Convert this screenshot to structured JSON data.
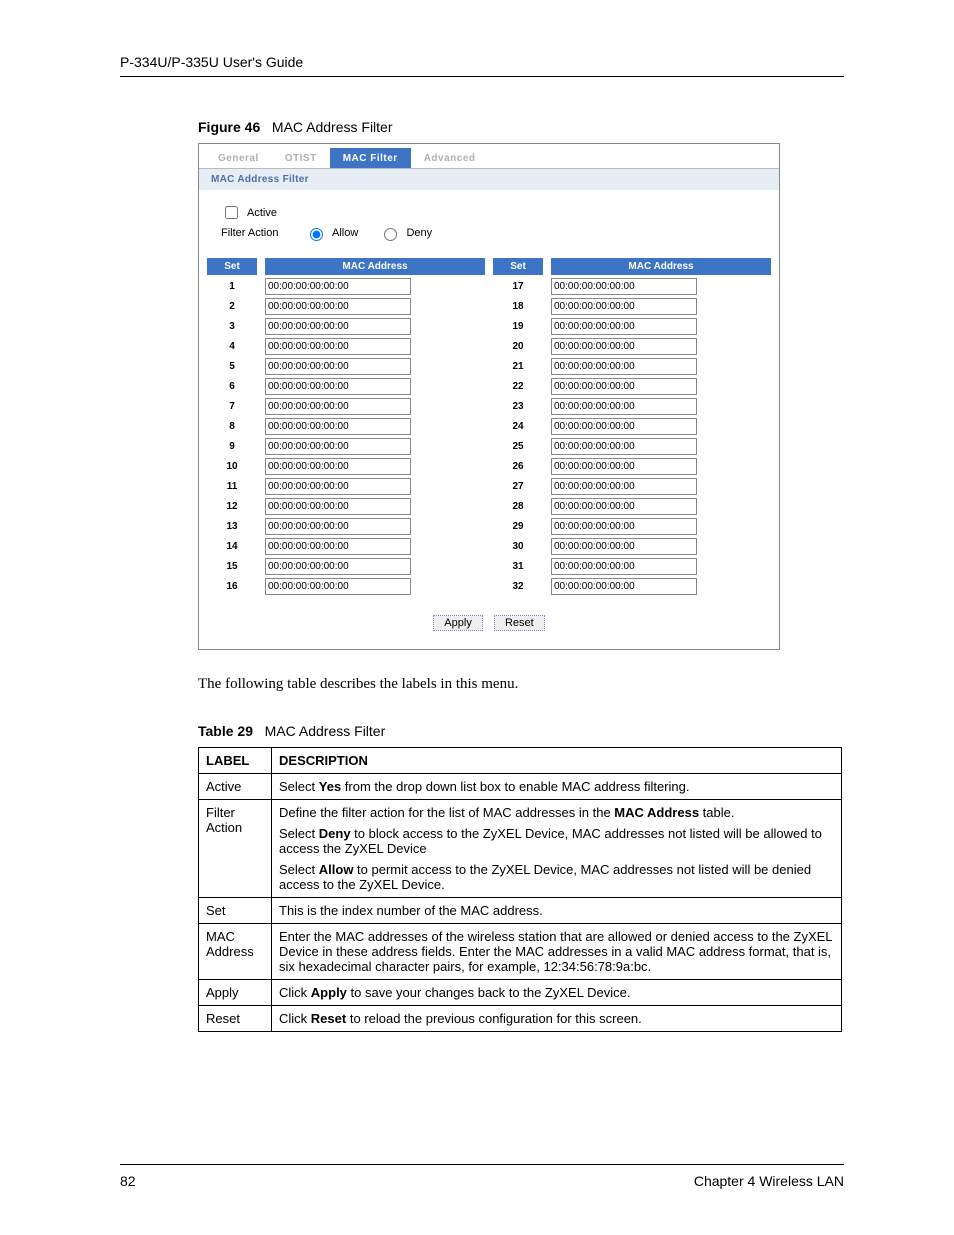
{
  "header": {
    "guide": "P-334U/P-335U User's Guide"
  },
  "figure": {
    "label": "Figure 46",
    "title": "MAC Address Filter"
  },
  "tabs": {
    "general": "General",
    "otist": "OTIST",
    "macfilter": "MAC Filter",
    "advanced": "Advanced"
  },
  "section": {
    "title": "MAC Address Filter"
  },
  "form": {
    "active_label": "Active",
    "filter_action_label": "Filter Action",
    "allow_label": "Allow",
    "deny_label": "Deny"
  },
  "grid_headers": {
    "set": "Set",
    "mac": "MAC Address"
  },
  "mac_rows": [
    {
      "n": "1",
      "v": "00:00:00:00:00:00"
    },
    {
      "n": "2",
      "v": "00:00:00:00:00:00"
    },
    {
      "n": "3",
      "v": "00:00:00:00:00:00"
    },
    {
      "n": "4",
      "v": "00:00:00:00:00:00"
    },
    {
      "n": "5",
      "v": "00:00:00:00:00:00"
    },
    {
      "n": "6",
      "v": "00:00:00:00:00:00"
    },
    {
      "n": "7",
      "v": "00:00:00:00:00:00"
    },
    {
      "n": "8",
      "v": "00:00:00:00:00:00"
    },
    {
      "n": "9",
      "v": "00:00:00:00:00:00"
    },
    {
      "n": "10",
      "v": "00:00:00:00:00:00"
    },
    {
      "n": "11",
      "v": "00:00:00:00:00:00"
    },
    {
      "n": "12",
      "v": "00:00:00:00:00:00"
    },
    {
      "n": "13",
      "v": "00:00:00:00:00:00"
    },
    {
      "n": "14",
      "v": "00:00:00:00:00:00"
    },
    {
      "n": "15",
      "v": "00:00:00:00:00:00"
    },
    {
      "n": "16",
      "v": "00:00:00:00:00:00"
    },
    {
      "n": "17",
      "v": "00:00:00:00:00:00"
    },
    {
      "n": "18",
      "v": "00:00:00:00:00:00"
    },
    {
      "n": "19",
      "v": "00:00:00:00:00:00"
    },
    {
      "n": "20",
      "v": "00:00:00:00:00:00"
    },
    {
      "n": "21",
      "v": "00:00:00:00:00:00"
    },
    {
      "n": "22",
      "v": "00:00:00:00:00:00"
    },
    {
      "n": "23",
      "v": "00:00:00:00:00:00"
    },
    {
      "n": "24",
      "v": "00:00:00:00:00:00"
    },
    {
      "n": "25",
      "v": "00:00:00:00:00:00"
    },
    {
      "n": "26",
      "v": "00:00:00:00:00:00"
    },
    {
      "n": "27",
      "v": "00:00:00:00:00:00"
    },
    {
      "n": "28",
      "v": "00:00:00:00:00:00"
    },
    {
      "n": "29",
      "v": "00:00:00:00:00:00"
    },
    {
      "n": "30",
      "v": "00:00:00:00:00:00"
    },
    {
      "n": "31",
      "v": "00:00:00:00:00:00"
    },
    {
      "n": "32",
      "v": "00:00:00:00:00:00"
    }
  ],
  "buttons": {
    "apply": "Apply",
    "reset": "Reset"
  },
  "paragraph": "The following table describes the labels in this menu.",
  "table_caption": {
    "label": "Table 29",
    "title": "MAC Address Filter"
  },
  "desc_table": {
    "headers": {
      "label": "LABEL",
      "desc": "DESCRIPTION"
    },
    "rows": {
      "active": {
        "label": "Active",
        "p1a": "Select ",
        "p1b": "Yes",
        "p1c": " from the drop down list box to enable MAC address filtering."
      },
      "filter_action": {
        "label": "Filter Action",
        "p1a": "Define the filter action for the list of MAC addresses in the ",
        "p1b": "MAC Address",
        "p1c": " table.",
        "p2a": "Select ",
        "p2b": "Deny",
        "p2c": " to block access to the ZyXEL Device, MAC addresses not listed will be allowed to access the ZyXEL Device",
        "p3a": "Select ",
        "p3b": "Allow",
        "p3c": " to permit access to the ZyXEL Device, MAC addresses not listed will be denied access to the ZyXEL Device."
      },
      "set": {
        "label": "Set",
        "p1": "This is the index number of the MAC address."
      },
      "mac": {
        "label": "MAC Address",
        "p1": "Enter the MAC addresses of the wireless station that are allowed or denied access to the ZyXEL Device in these address fields. Enter the MAC addresses in a valid MAC address format, that is, six hexadecimal character pairs, for example, 12:34:56:78:9a:bc."
      },
      "apply": {
        "label": "Apply",
        "p1a": "Click ",
        "p1b": "Apply",
        "p1c": " to save your changes back to the ZyXEL Device."
      },
      "reset": {
        "label": "Reset",
        "p1a": "Click ",
        "p1b": "Reset",
        "p1c": " to reload the previous configuration for this screen."
      }
    }
  },
  "footer": {
    "page": "82",
    "chapter": "Chapter 4 Wireless LAN"
  }
}
